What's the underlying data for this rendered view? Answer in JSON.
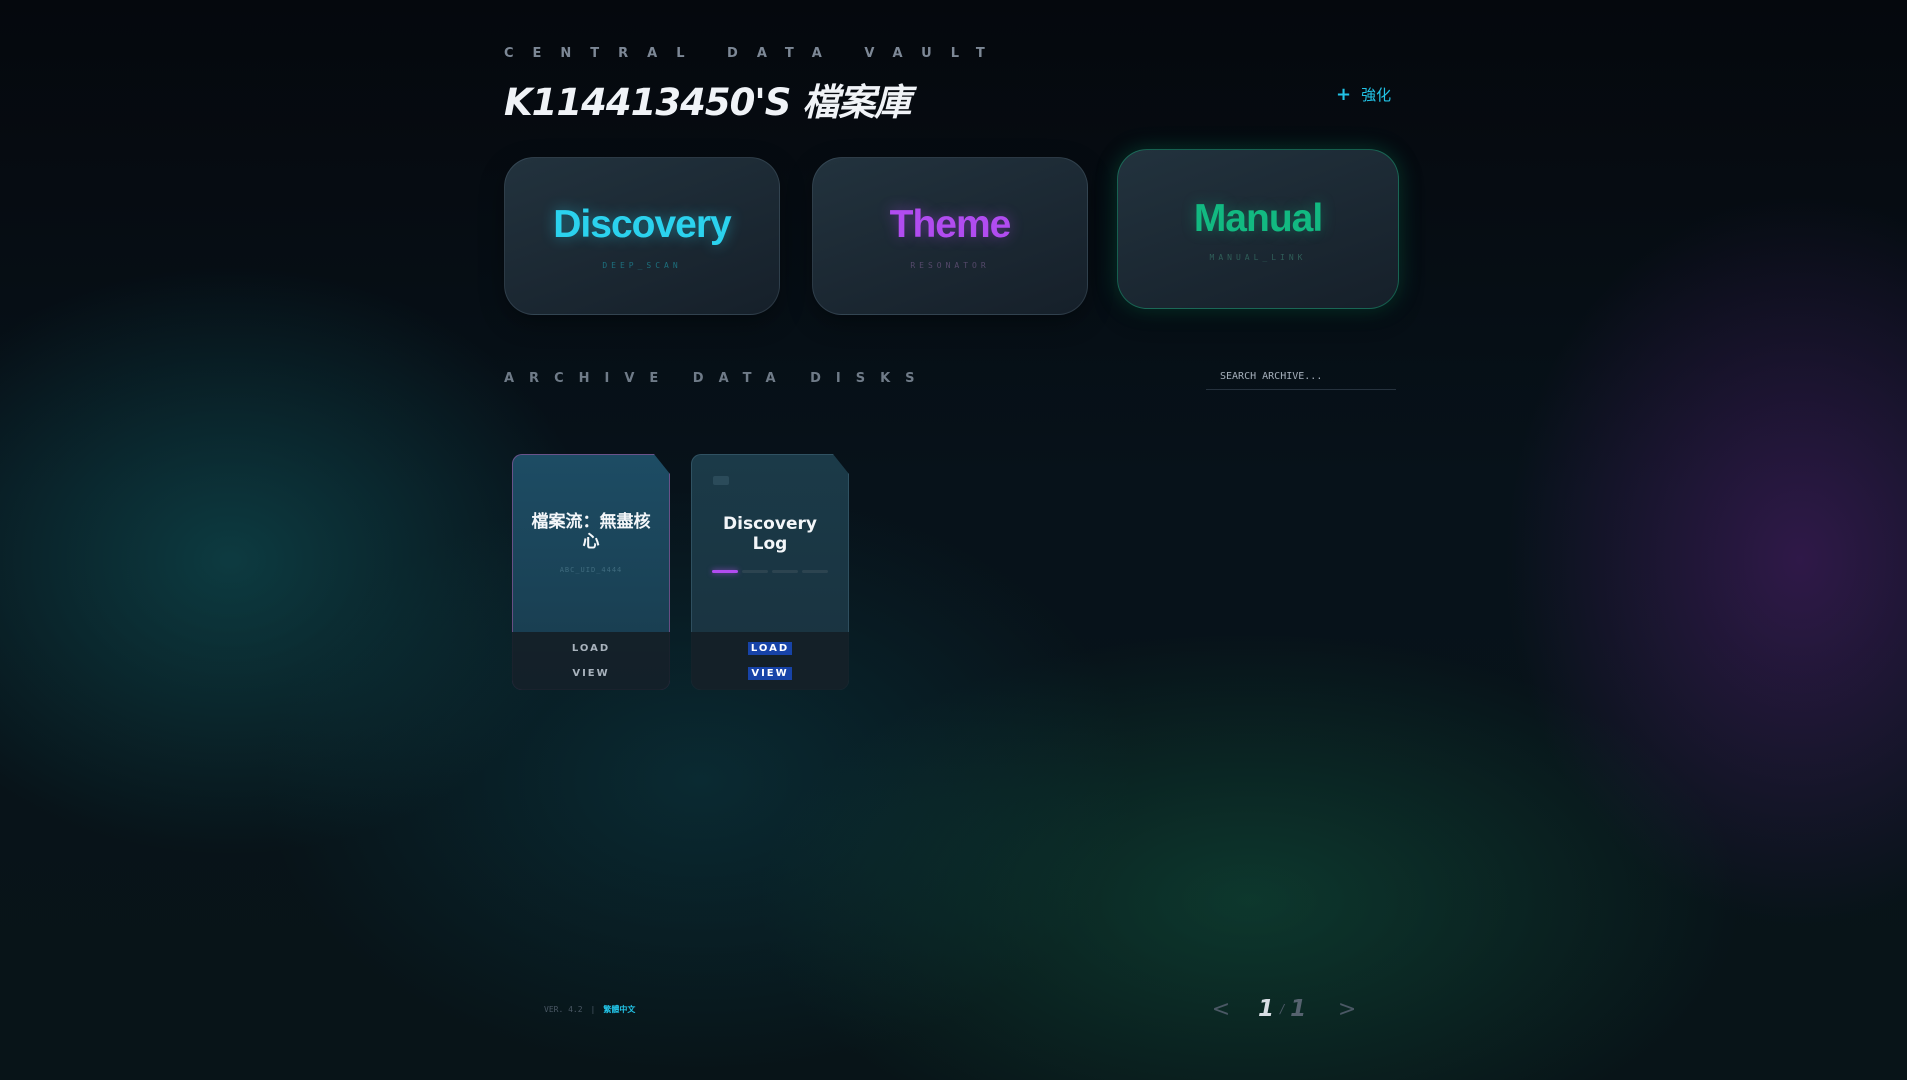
{
  "header": {
    "eyebrow": "CENTRAL DATA VAULT",
    "title": "K114413450'S 檔案庫",
    "enhance_icon": "plus-icon",
    "enhance_label": "強化",
    "accent_color": "#22c3e6"
  },
  "modes": [
    {
      "name": "Discovery",
      "sub": "DEEP_SCAN",
      "color": "#2bd2ee"
    },
    {
      "name": "Theme",
      "sub": "RESONATOR",
      "color": "#b14cf0"
    },
    {
      "name": "Manual",
      "sub": "MANUAL_LINK",
      "color": "#12b981"
    }
  ],
  "archive": {
    "section_label": "ARCHIVE DATA DISKS",
    "search_placeholder": "SEARCH ARCHIVE...",
    "disks": [
      {
        "title": "檔案流：無盡核心",
        "uid": "ABC_UID_4444",
        "load_label": "LOAD",
        "view_label": "VIEW"
      },
      {
        "title": "Discovery Log",
        "chip_icon": "chip-icon",
        "progress_filled": 1,
        "progress_total": 4,
        "load_label": "LOAD",
        "view_label": "VIEW"
      }
    ]
  },
  "footer": {
    "version": "VER. 4.2",
    "divider": "|",
    "language": "繁體中文"
  },
  "pagination": {
    "prev": "<",
    "current": "1",
    "separator": "/",
    "total": "1",
    "next": ">"
  }
}
